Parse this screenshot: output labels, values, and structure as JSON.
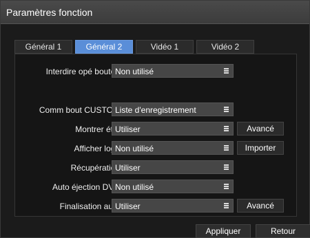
{
  "window": {
    "title": "Paramètres fonction"
  },
  "tabs": [
    {
      "label": "Général 1",
      "active": false
    },
    {
      "label": "Général 2",
      "active": true
    },
    {
      "label": "Vidéo 1",
      "active": false
    },
    {
      "label": "Vidéo 2",
      "active": false
    }
  ],
  "settings": [
    {
      "label": "Interdire opé bouton",
      "value": "Non utilisé",
      "button": ""
    },
    {
      "label": "Comm bout CUSTOM",
      "value": "Liste d'enregistrement",
      "button": ""
    },
    {
      "label": "Montrer état",
      "value": "Utiliser",
      "button": "Avancé"
    },
    {
      "label": "Afficher logo",
      "value": "Non utilisé",
      "button": "Importer"
    },
    {
      "label": "Récupération",
      "value": "Utiliser",
      "button": ""
    },
    {
      "label": "Auto éjection DVD",
      "value": "Non utilisé",
      "button": ""
    },
    {
      "label": "Finalisation auto",
      "value": "Utiliser",
      "button": "Avancé"
    }
  ],
  "footer": {
    "apply_label": "Appliquer",
    "back_label": "Retour"
  },
  "colors": {
    "active_tab": "#5a8ed8",
    "dropdown_bg": "#464646",
    "background": "#151515"
  },
  "icons": {
    "dropdown": "menu-lines-icon"
  }
}
